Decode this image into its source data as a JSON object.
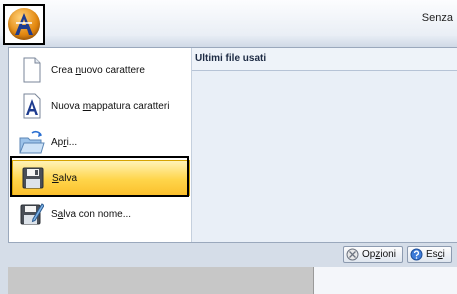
{
  "window": {
    "title": "Senza"
  },
  "app_button": {
    "icon": "app-logo-icon"
  },
  "commands": [
    {
      "id": "new",
      "icon": "blank-page-icon",
      "pre": "Crea ",
      "accel": "n",
      "post": "uovo carattere"
    },
    {
      "id": "mapping",
      "icon": "font-mapping-icon",
      "pre": "Nuova ",
      "accel": "m",
      "post": "appatura caratteri"
    },
    {
      "id": "open",
      "icon": "open-folder-icon",
      "pre": "Ap",
      "accel": "r",
      "post": "i..."
    },
    {
      "id": "save",
      "icon": "floppy-disk-icon",
      "pre": "",
      "accel": "S",
      "post": "alva",
      "selected": true
    },
    {
      "id": "saveas",
      "icon": "save-as-icon",
      "pre": "S",
      "accel": "a",
      "post": "lva con nome..."
    }
  ],
  "recent": {
    "title": "Ultimi file usati"
  },
  "footer": {
    "options": {
      "pre": "Op",
      "accel": "z",
      "post": "ioni",
      "icon": "options-icon"
    },
    "exit": {
      "pre": "Es",
      "accel": "c",
      "post": "i",
      "icon": "help-exit-icon"
    }
  },
  "colors": {
    "selected": "#ffd54a",
    "panel": "#e9eff7",
    "chrome": "#d5dde8"
  }
}
